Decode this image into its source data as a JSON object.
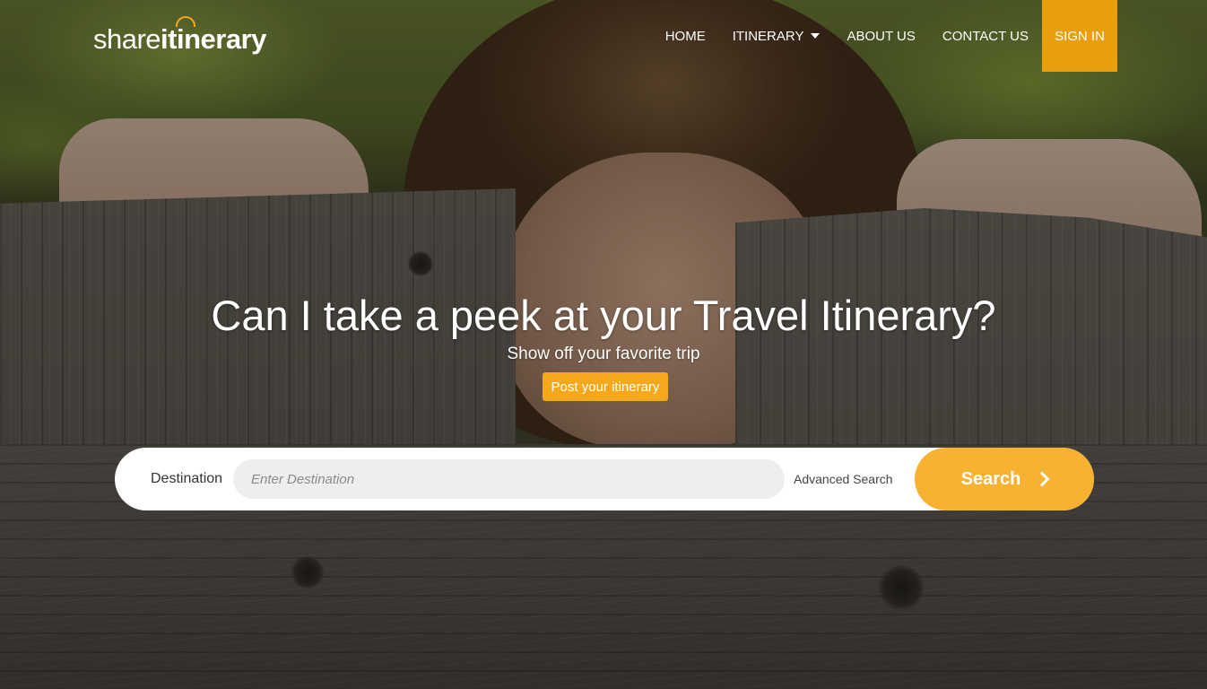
{
  "brand": {
    "logo_thin": "share",
    "logo_bold": "itinerary",
    "accent_color": "#f5a81c"
  },
  "nav": {
    "items": [
      {
        "label": "HOME"
      },
      {
        "label": "ITINERARY",
        "icon": "caret-down-icon"
      },
      {
        "label": "ABOUT US"
      },
      {
        "label": "CONTACT US"
      }
    ],
    "signin_label": "SIGN IN",
    "signin_color": "#e99e0b"
  },
  "hero": {
    "headline": "Can I take a peek at your Travel Itinerary?",
    "subline": "Show off your favorite trip",
    "post_button": "Post your itinerary"
  },
  "search": {
    "destination_label": "Destination",
    "destination_placeholder": "Enter Destination",
    "destination_value": "",
    "advanced_label": "Advanced Search",
    "button_label": "Search",
    "button_icon": "chevron-right-icon",
    "button_color": "#f7b231"
  }
}
